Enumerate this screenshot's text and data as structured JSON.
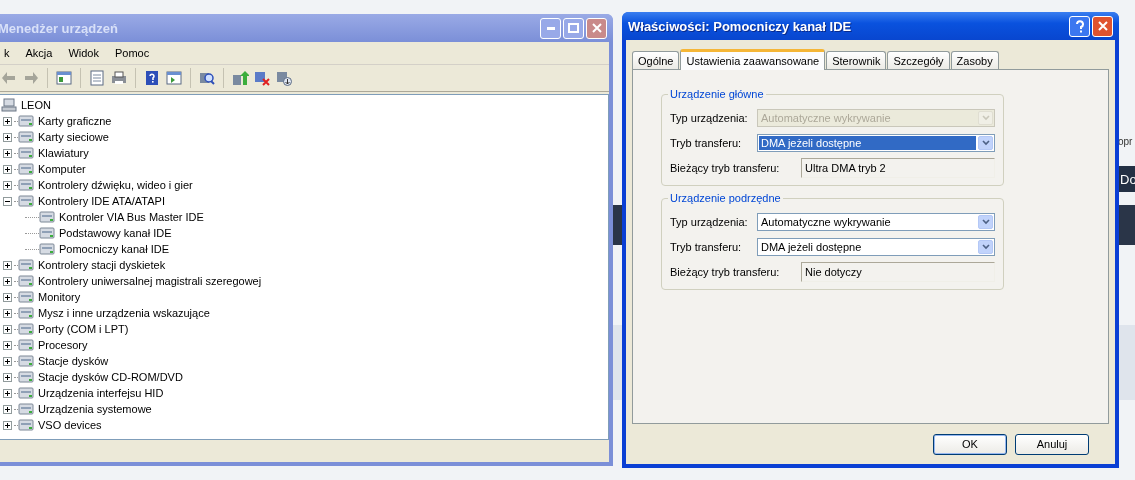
{
  "background_page": {
    "edge_link": "opr",
    "edge_banner": "Do"
  },
  "device_manager": {
    "title": "Menedżer urządzeń",
    "menu": [
      "k",
      "Akcja",
      "Widok",
      "Pomoc"
    ],
    "tree": {
      "label": "LEON",
      "children": [
        {
          "label": "Karty graficzne",
          "expanded": false
        },
        {
          "label": "Karty sieciowe",
          "expanded": false
        },
        {
          "label": "Klawiatury",
          "expanded": false
        },
        {
          "label": "Komputer",
          "expanded": false
        },
        {
          "label": "Kontrolery dźwięku, wideo i gier",
          "expanded": false
        },
        {
          "label": "Kontrolery IDE ATA/ATAPI",
          "expanded": true,
          "children": [
            {
              "label": "Kontroler VIA Bus Master IDE"
            },
            {
              "label": "Podstawowy kanał IDE"
            },
            {
              "label": "Pomocniczy kanał IDE"
            }
          ]
        },
        {
          "label": "Kontrolery stacji dyskietek",
          "expanded": false
        },
        {
          "label": "Kontrolery uniwersalnej magistrali szeregowej",
          "expanded": false
        },
        {
          "label": "Monitory",
          "expanded": false
        },
        {
          "label": "Mysz i inne urządzenia wskazujące",
          "expanded": false
        },
        {
          "label": "Porty (COM i LPT)",
          "expanded": false
        },
        {
          "label": "Procesory",
          "expanded": false
        },
        {
          "label": "Stacje dysków",
          "expanded": false
        },
        {
          "label": "Stacje dysków CD-ROM/DVD",
          "expanded": false
        },
        {
          "label": "Urządzenia interfejsu HID",
          "expanded": false
        },
        {
          "label": "Urządzenia systemowe",
          "expanded": false
        },
        {
          "label": "VSO devices",
          "expanded": false
        }
      ]
    }
  },
  "dialog": {
    "title": "Właściwości: Pomocniczy kanał IDE",
    "tabs": [
      {
        "label": "Ogólne",
        "selected": false
      },
      {
        "label": "Ustawienia zaawansowane",
        "selected": true
      },
      {
        "label": "Sterownik",
        "selected": false
      },
      {
        "label": "Szczegóły",
        "selected": false
      },
      {
        "label": "Zasoby",
        "selected": false
      }
    ],
    "groups": [
      {
        "legend": "Urządzenie główne",
        "rows": [
          {
            "kind": "select",
            "label": "Typ urządzenia:",
            "value": "Automatyczne wykrywanie",
            "disabled": true,
            "focused": false
          },
          {
            "kind": "select",
            "label": "Tryb transferu:",
            "value": "DMA jeżeli dostępne",
            "disabled": false,
            "focused": true
          },
          {
            "kind": "readonly",
            "label": "Bieżący tryb transferu:",
            "value": "Ultra DMA tryb 2"
          }
        ]
      },
      {
        "legend": "Urządzenie podrzędne",
        "rows": [
          {
            "kind": "select",
            "label": "Typ urządzenia:",
            "value": "Automatyczne wykrywanie",
            "disabled": false,
            "focused": false
          },
          {
            "kind": "select",
            "label": "Tryb transferu:",
            "value": "DMA jeżeli dostępne",
            "disabled": false,
            "focused": false
          },
          {
            "kind": "readonly",
            "label": "Bieżący tryb transferu:",
            "value": "Nie dotyczy"
          }
        ]
      }
    ],
    "buttons": [
      {
        "label": "OK",
        "default": true
      },
      {
        "label": "Anuluj",
        "default": false
      }
    ]
  }
}
